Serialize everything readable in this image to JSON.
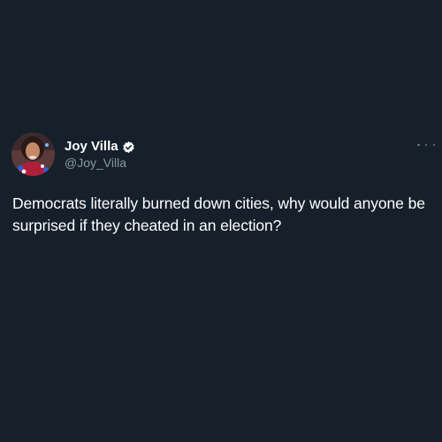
{
  "author": {
    "display_name": "Joy Villa",
    "handle": "@Joy_Villa",
    "verified": true,
    "avatar_icon": "profile-photo"
  },
  "tweet": {
    "text": "Democrats literally burned down cities, why would anyone be\nsurprised if they cheated in an election?"
  },
  "menu": {
    "icon": "more-options-icon"
  },
  "colors": {
    "background": "#15202b",
    "primary_text": "#ffffff",
    "secondary_text": "#8b98a5",
    "verified_badge": "#ffffff"
  }
}
